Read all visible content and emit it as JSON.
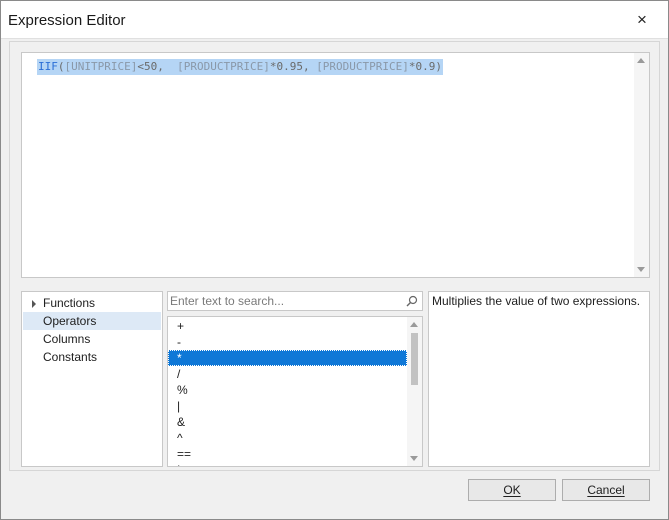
{
  "window": {
    "title": "Expression Editor",
    "close_glyph": "×"
  },
  "editor": {
    "tokens": [
      {
        "text": "IIF",
        "kind": "fn"
      },
      {
        "text": "(",
        "kind": "op"
      },
      {
        "text": "[UNITPRICE]",
        "kind": "col"
      },
      {
        "text": "<50,  ",
        "kind": "op"
      },
      {
        "text": "[PRODUCTPRICE]",
        "kind": "col"
      },
      {
        "text": "*0.95, ",
        "kind": "op"
      },
      {
        "text": "[PRODUCTPRICE]",
        "kind": "col"
      },
      {
        "text": "*0.9)",
        "kind": "op"
      }
    ]
  },
  "categories": {
    "items": [
      {
        "label": "Functions",
        "expandable": true,
        "selected": false
      },
      {
        "label": "Operators",
        "expandable": false,
        "selected": true
      },
      {
        "label": "Columns",
        "expandable": false,
        "selected": false
      },
      {
        "label": "Constants",
        "expandable": false,
        "selected": false
      }
    ]
  },
  "search": {
    "placeholder": "Enter text to search...",
    "value": ""
  },
  "operators": {
    "items": [
      "+",
      "-",
      "*",
      "/",
      "%",
      "|",
      "&",
      "^",
      "==",
      "!"
    ],
    "selected_index": 2
  },
  "description": {
    "text": "Multiplies the value of two expressions."
  },
  "buttons": {
    "ok_label": "OK",
    "cancel_label": "Cancel"
  },
  "colors": {
    "selection": "#0f78d7",
    "editor_highlight": "#b5d5f5"
  }
}
